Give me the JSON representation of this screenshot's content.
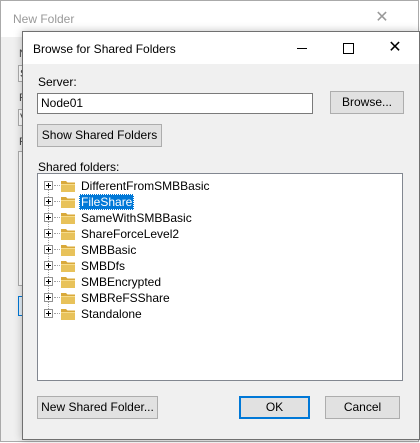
{
  "background_window": {
    "title": "New Folder",
    "fragments": [
      "N",
      "S",
      "F",
      "V",
      "F"
    ]
  },
  "dialog": {
    "title": "Browse for Shared Folders",
    "server_label": "Server:",
    "server_value": "Node01",
    "browse_button": "Browse...",
    "show_shared_button": "Show Shared Folders",
    "shared_folders_label": "Shared folders:",
    "shared_folders": [
      {
        "label": "DifferentFromSMBBasic",
        "selected": false
      },
      {
        "label": "FileShare",
        "selected": true
      },
      {
        "label": "SameWithSMBBasic",
        "selected": false
      },
      {
        "label": "ShareForceLevel2",
        "selected": false
      },
      {
        "label": "SMBBasic",
        "selected": false
      },
      {
        "label": "SMBDfs",
        "selected": false
      },
      {
        "label": "SMBEncrypted",
        "selected": false
      },
      {
        "label": "SMBReFSShare",
        "selected": false
      },
      {
        "label": "Standalone",
        "selected": false
      }
    ],
    "new_shared_folder_button": "New Shared Folder...",
    "ok_button": "OK",
    "cancel_button": "Cancel"
  },
  "colors": {
    "selection": "#0078d7",
    "folder": "#e8c25a"
  }
}
